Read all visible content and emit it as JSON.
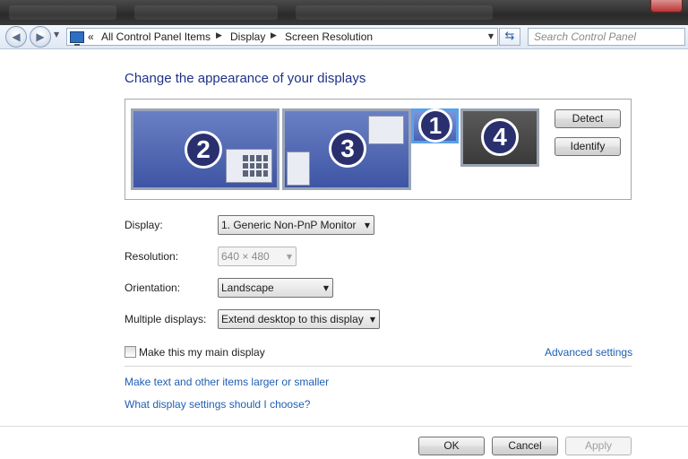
{
  "address_bar": {
    "overflow": "«",
    "crumbs": [
      "All Control Panel Items",
      "Display",
      "Screen Resolution"
    ],
    "search_placeholder": "Search Control Panel"
  },
  "page": {
    "title": "Change the appearance of your displays"
  },
  "monitors": [
    {
      "number": "2",
      "state": "normal"
    },
    {
      "number": "3",
      "state": "normal"
    },
    {
      "number": "1",
      "state": "selected"
    },
    {
      "number": "4",
      "state": "inactive"
    }
  ],
  "buttons": {
    "detect": "Detect",
    "identify": "Identify",
    "ok": "OK",
    "cancel": "Cancel",
    "apply": "Apply"
  },
  "form": {
    "display": {
      "label": "Display:",
      "value": "1. Generic Non-PnP Monitor"
    },
    "resolution": {
      "label": "Resolution:",
      "value": "640 × 480",
      "disabled": true
    },
    "orientation": {
      "label": "Orientation:",
      "value": "Landscape"
    },
    "multiple": {
      "label": "Multiple displays:",
      "value": "Extend desktop to this display"
    },
    "main_display": {
      "label": "Make this my main display",
      "checked": false
    }
  },
  "links": {
    "advanced": "Advanced settings",
    "text_size": "Make text and other items larger or smaller",
    "which_settings": "What display settings should I choose?"
  },
  "colors": {
    "title": "#1e3287",
    "link": "#1e5fb4",
    "monitor_blue": "#4a63b4",
    "monitor_inactive": "#4a4a4a"
  }
}
